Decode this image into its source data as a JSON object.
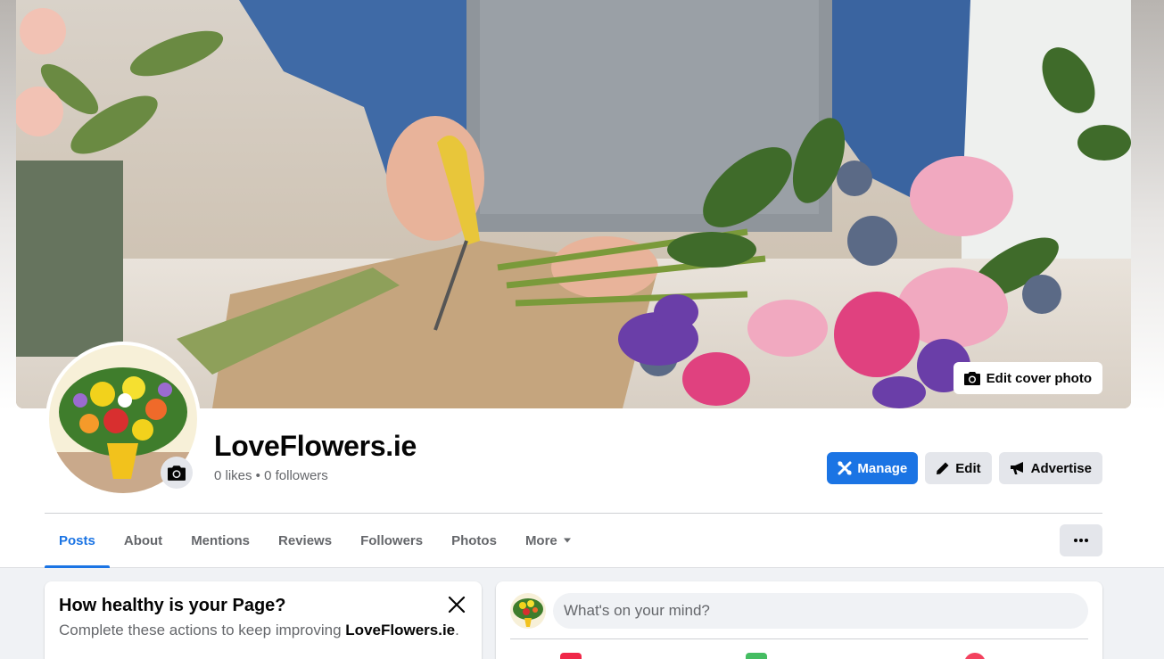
{
  "cover": {
    "edit_cover_label": "Edit cover photo"
  },
  "page": {
    "name": "LoveFlowers.ie",
    "stats": "0 likes • 0 followers"
  },
  "actions": {
    "manage_label": "Manage",
    "edit_label": "Edit",
    "advertise_label": "Advertise"
  },
  "tabs": [
    {
      "label": "Posts",
      "active": true
    },
    {
      "label": "About"
    },
    {
      "label": "Mentions"
    },
    {
      "label": "Reviews"
    },
    {
      "label": "Followers"
    },
    {
      "label": "Photos"
    },
    {
      "label": "More"
    }
  ],
  "health_card": {
    "title": "How healthy is your Page?",
    "subtitle_prefix": "Complete these actions to keep improving ",
    "subtitle_page": "LoveFlowers.ie",
    "subtitle_suffix": "."
  },
  "composer": {
    "placeholder": "What's on your mind?"
  },
  "colors": {
    "accent": "#1b74e4",
    "secondary_button": "#e4e6eb",
    "background": "#f0f2f5"
  },
  "icons": {
    "camera": "camera-icon",
    "manage": "manage-icon",
    "edit": "pencil-icon",
    "advertise": "megaphone-icon",
    "more": "caret-down-icon",
    "options": "more-dots-icon",
    "close": "close-icon"
  }
}
